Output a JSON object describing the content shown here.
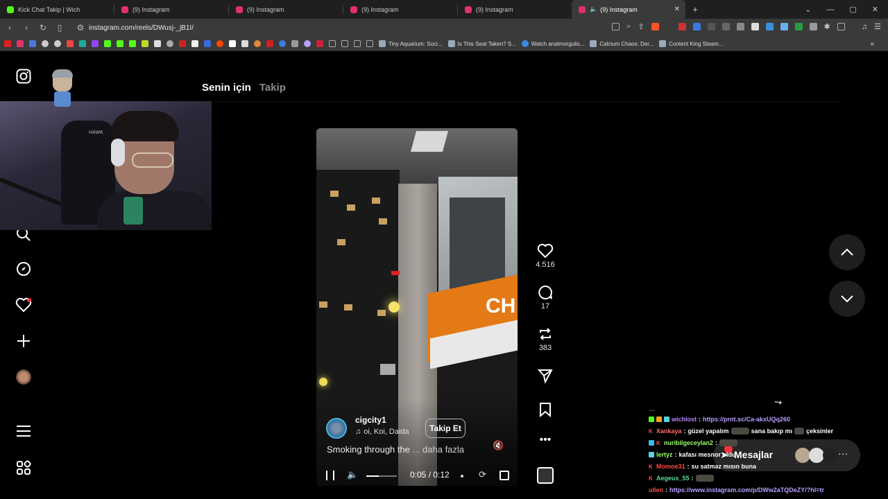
{
  "browser": {
    "tabs": [
      {
        "title": "Kick Chat Takip | Wich",
        "favicon_color": "#3a3a3a"
      },
      {
        "title": "(9) Instagram",
        "favicon_color": "#e1306c"
      },
      {
        "title": "(9) Instagram",
        "favicon_color": "#e1306c"
      },
      {
        "title": "(9) Instagram",
        "favicon_color": "#e1306c"
      },
      {
        "title": "(9) Instagram",
        "favicon_color": "#e1306c"
      },
      {
        "title": "(9) Instagram",
        "favicon_color": "#e1306c",
        "active": true
      }
    ],
    "url": "instagram.com/reels/DWusj-_jB1I/",
    "bookmarks": [
      "Tiny Aquarium: Soci...",
      "Is This Seat Taken? S...",
      "Watch analmorgulis...",
      "Calcium Chaos: Der...",
      "Content King Steam..."
    ]
  },
  "feed_tabs": {
    "for_you": "Senin için",
    "following": "Takip"
  },
  "reel": {
    "username": "cigcity1",
    "music": "oi, Koi, Daida",
    "follow_label": "Takip Et",
    "caption": "Smoking through the",
    "caption_more": "... daha fazla",
    "sign_text": "CH",
    "time": "0:05 / 0:12",
    "progress": 0.42
  },
  "actions": {
    "likes": "4.516",
    "comments": "17",
    "reposts": "383"
  },
  "messages": {
    "label": "Mesajlar"
  },
  "chat": [
    {
      "user": "wichlost",
      "user_color": "#b085f5",
      "text": "",
      "link": "https://prnt.sc/Ca-akxUQq260"
    },
    {
      "user": "Xankaya",
      "user_color": "#ff6a6a",
      "text": "güzel yapalım",
      "text2": "sana bakıp mı",
      "text3": "çeksinler"
    },
    {
      "user": "nuribilgeceylan2",
      "user_color": "#9cff6a",
      "text": ""
    },
    {
      "user": "lertyz",
      "user_color": "#9cff6a",
      "text": "kafası mesnor oldu"
    },
    {
      "user": "Momoe31",
      "user_color": "#ff4a4a",
      "text": "su satmaz mısın buna"
    },
    {
      "user": "Aegeus_55",
      "user_color": "#5dd8a0",
      "text": ""
    },
    {
      "user": "ullen",
      "user_color": "#ff4a4a",
      "text": "",
      "link": "https://www.instagram.com/p/DWw2aTQDeZY/?hl=tr"
    }
  ]
}
